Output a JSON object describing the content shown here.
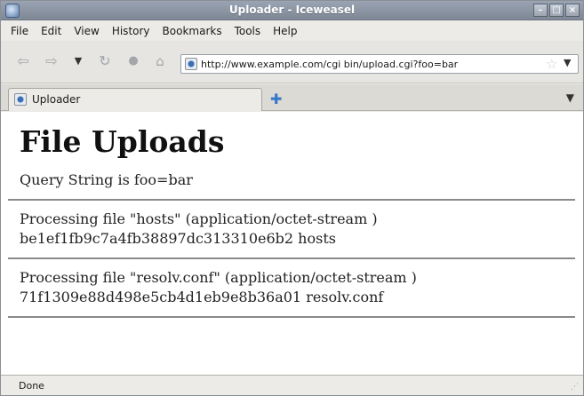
{
  "window": {
    "title": "Uploader - Iceweasel"
  },
  "menu": [
    "File",
    "Edit",
    "View",
    "History",
    "Bookmarks",
    "Tools",
    "Help"
  ],
  "nav": {
    "url": "http://www.example.com/cgi bin/upload.cgi?foo=bar"
  },
  "tabs": [
    {
      "label": "Uploader"
    }
  ],
  "page": {
    "heading": "File Uploads",
    "query_line": "Query String is foo=bar",
    "files": [
      {
        "processing": "Processing file \"hosts\" (application/octet-stream )",
        "hash_line": "be1ef1fb9c7a4fb38897dc313310e6b2 hosts"
      },
      {
        "processing": "Processing file \"resolv.conf\" (application/octet-stream )",
        "hash_line": "71f1309e88d498e5cb4d1eb9e8b36a01 resolv.conf"
      }
    ]
  },
  "status": {
    "text": "Done"
  },
  "icons": {
    "back": "back-arrow-icon",
    "forward": "forward-arrow-icon",
    "history_dropdown": "chevron-down-icon",
    "reload": "reload-icon",
    "stop": "stop-icon",
    "home": "home-icon",
    "site": "site-favicon-icon",
    "bookmark_star": "star-icon",
    "new_tab": "plus-icon",
    "tab_list": "chevron-down-icon"
  }
}
